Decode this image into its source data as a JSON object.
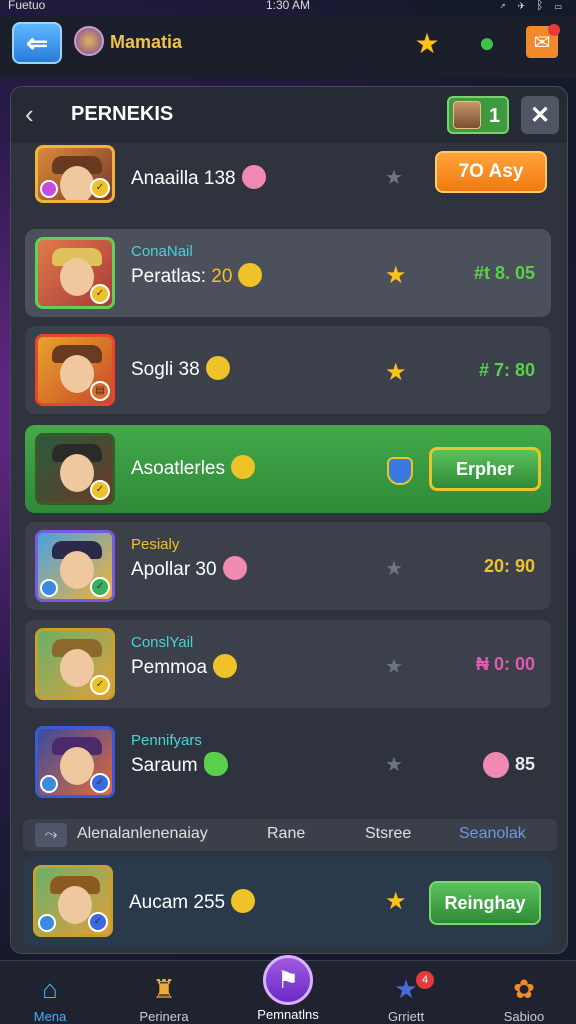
{
  "status_bar": {
    "left": "Fuetuo",
    "time": "1:30 AM",
    "right": "↗ ✈ ᛒ ▭"
  },
  "topbar": {
    "app_title": "Mamatia"
  },
  "panel": {
    "title": "PERNEKIS",
    "counter": "1",
    "back_icon": "‹",
    "close_icon": "✕"
  },
  "rows": [
    {
      "name": "Anaailla 138",
      "button": "7O Asy"
    },
    {
      "subname": "ConaNail",
      "name": "Peratlas:",
      "name_value": "20",
      "score": "#t 8. 05"
    },
    {
      "name": "Sogli 38",
      "score": "# 7: 80"
    },
    {
      "name": "Asoatlerles",
      "button": "Erpher"
    },
    {
      "subname": "Pesialy",
      "name": "Apollar 30",
      "score": "20: 90"
    },
    {
      "subname": "ConslYail",
      "name": "Pemmoa",
      "score": "₦ 0: 00"
    },
    {
      "subname": "Pennifyars",
      "name": "Saraum",
      "score": "85"
    }
  ],
  "filter_tabs": [
    "Alenalanlenenaiay",
    "Rane",
    "Stsree",
    "Seanolak"
  ],
  "bottom_row": {
    "name": "Aucam 255",
    "button": "Reinghay"
  },
  "tabs": [
    {
      "label": "Mena"
    },
    {
      "label": "Perinera"
    },
    {
      "label": "Pemnatlns"
    },
    {
      "label": "Grriett",
      "badge": "4"
    },
    {
      "label": "Sabioo"
    }
  ],
  "colors": {
    "accent": "#f0c22a",
    "green": "#43a94a",
    "panel": "#2e333e"
  }
}
